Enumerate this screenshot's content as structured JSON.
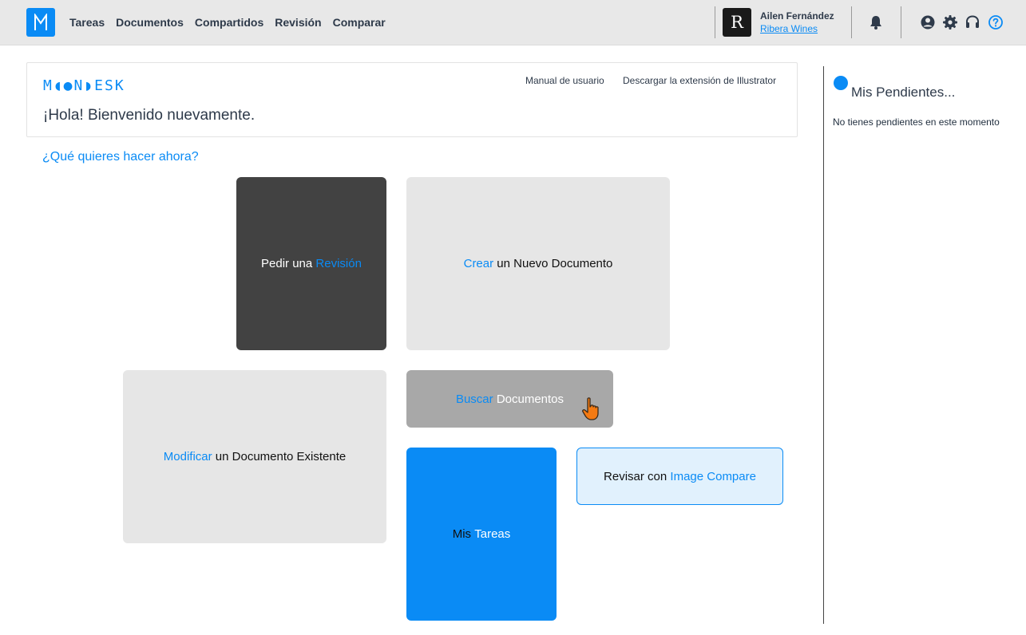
{
  "navbar": {
    "items": [
      "Tareas",
      "Documentos",
      "Compartidos",
      "Revisión",
      "Comparar"
    ],
    "user": {
      "avatar_letter": "R",
      "name": "Ailen Fernández",
      "company": "Ribera Wines"
    }
  },
  "welcome": {
    "brand": "M◖●N◗ESK",
    "greeting": "¡Hola! Bienvenido nuevamente.",
    "links": {
      "manual": "Manual de usuario",
      "extension": "Descargar la extensión de Illustrator"
    }
  },
  "question": "¿Qué quieres hacer ahora?",
  "tiles": {
    "revision": {
      "pre": "Pedir una ",
      "accent": "Revisión"
    },
    "crear": {
      "accent": "Crear",
      "post": " un Nuevo Documento"
    },
    "modificar": {
      "accent": "Modificar",
      "post": " un Documento Existente"
    },
    "buscar": {
      "accent": "Buscar",
      "post": " Documentos"
    },
    "tareas": {
      "pre": "Mis ",
      "accent": "Tareas"
    },
    "compare": {
      "pre": "Revisar con ",
      "accent": "Image Compare"
    }
  },
  "pendientes": {
    "title": "Mis Pendientes...",
    "empty": "No tienes pendientes en este momento"
  },
  "colors": {
    "brand": "#0a8bf5",
    "dark_tile": "#424242",
    "light_tile": "#e6e6e6",
    "grey_tile": "#a8a8a8",
    "compare_bg": "#e1f1fd",
    "navbar_bg": "#e8e8e8"
  },
  "icons": [
    "moondesk-logo-icon",
    "bell-icon",
    "user-circle-icon",
    "gear-icon",
    "headset-icon",
    "help-icon",
    "hand-pointer-icon"
  ]
}
